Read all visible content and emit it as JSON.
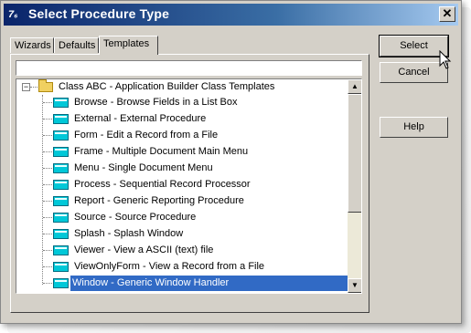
{
  "window": {
    "app_icon": "7₆",
    "title": "Select Procedure Type",
    "close_label": "✕"
  },
  "tabs": [
    "Wizards",
    "Defaults",
    "Templates"
  ],
  "active_tab": "Templates",
  "filter": {
    "value": "",
    "placeholder": ""
  },
  "tree": {
    "root": {
      "label": "Class ABC - Application Builder Class Templates",
      "expander": "−"
    },
    "items": [
      "Browse - Browse Fields in a List Box",
      "External - External Procedure",
      "Form - Edit a Record from a File",
      "Frame - Multiple Document Main Menu",
      "Menu - Single Document Menu",
      "Process - Sequential Record Processor",
      "Report - Generic Reporting Procedure",
      "Source - Source Procedure",
      "Splash - Splash Window",
      "Viewer - View a ASCII (text) file",
      "ViewOnlyForm - View a Record from a File",
      "Window - Generic Window Handler"
    ],
    "selected": "Window - Generic Window Handler"
  },
  "buttons": {
    "select": "Select",
    "cancel": "Cancel",
    "help": "Help"
  },
  "icons": {
    "folder": "folder-icon",
    "template": "template-icon",
    "cursor": "mouse-pointer-icon"
  },
  "colors": {
    "titlebar_start": "#0a246a",
    "titlebar_end": "#a6caf0",
    "selection": "#316ac5",
    "dialog_bg": "#d4d0c8"
  }
}
